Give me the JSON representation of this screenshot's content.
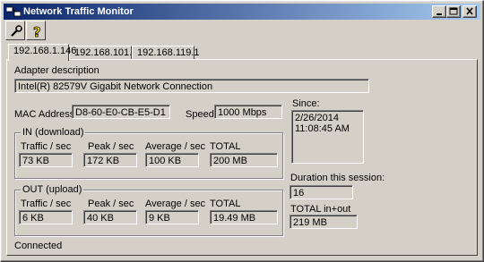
{
  "window": {
    "title": "Network Traffic Monitor"
  },
  "tabs": [
    {
      "label": "192.168.1.146"
    },
    {
      "label": "192.168.101.1"
    },
    {
      "label": "192.168.119.1"
    }
  ],
  "adapter": {
    "label": "Adapter description",
    "value": "Intel(R) 82579V Gigabit Network Connection"
  },
  "mac": {
    "label": "MAC Address",
    "value": "D8-60-E0-CB-E5-D1"
  },
  "speed": {
    "label": "Speed",
    "value": "1000 Mbps"
  },
  "since": {
    "label": "Since:",
    "date": "2/26/2014",
    "time": "11:08:45 AM"
  },
  "in": {
    "legend": "IN (download)",
    "headers": [
      "Traffic / sec",
      "Peak / sec",
      "Average / sec",
      "TOTAL"
    ],
    "values": [
      "73 KB",
      "172 KB",
      "100 KB",
      "200 MB"
    ]
  },
  "out": {
    "legend": "OUT (upload)",
    "headers": [
      "Traffic / sec",
      "Peak / sec",
      "Average / sec",
      "TOTAL"
    ],
    "values": [
      "6 KB",
      "40 KB",
      "9 KB",
      "19.49 MB"
    ]
  },
  "duration": {
    "label": "Duration this session:",
    "value": "16"
  },
  "total": {
    "label": "TOTAL in+out",
    "value": "219 MB"
  },
  "status": "Connected"
}
